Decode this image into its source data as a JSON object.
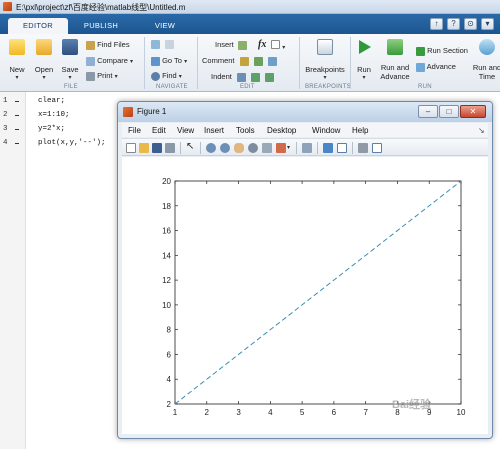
{
  "window": {
    "title": "E:\\pxl\\project\\zf\\百度经验\\matlab线型\\Untitled.m"
  },
  "tabs": [
    {
      "label": "EDITOR"
    },
    {
      "label": "PUBLISH"
    },
    {
      "label": "VIEW"
    }
  ],
  "window_buttons": [
    "↑",
    "?",
    "⊙",
    "▾"
  ],
  "ribbon": {
    "file": {
      "group": "FILE",
      "new": "New",
      "open": "Open",
      "save": "Save",
      "find_files": "Find Files",
      "compare": "Compare",
      "print": "Print"
    },
    "navigate": {
      "group": "NAVIGATE",
      "goto": "Go To",
      "find": "Find"
    },
    "edit": {
      "group": "EDIT",
      "insert": "Insert",
      "fx": "fx",
      "comment": "Comment",
      "indent": "Indent"
    },
    "breakpoints": {
      "group": "BREAKPOINTS",
      "label": "Breakpoints"
    },
    "run": {
      "group": "RUN",
      "run": "Run",
      "run_and_advance_1": "Run and",
      "run_and_advance_2": "Advance",
      "run_section": "Run Section",
      "advance": "Advance",
      "run_and_time_1": "Run and",
      "run_and_time_2": "Time"
    }
  },
  "editor": {
    "lines": [
      {
        "num": "1",
        "code": "clear;"
      },
      {
        "num": "2",
        "code": "x=1:10;"
      },
      {
        "num": "3",
        "code": "y=2*x;"
      },
      {
        "num": "4",
        "code": "plot(x,y,'--');"
      }
    ]
  },
  "figure": {
    "title": "Figure 1",
    "menu": [
      "File",
      "Edit",
      "View",
      "Insert",
      "Tools",
      "Desktop",
      "Window",
      "Help"
    ],
    "title_buttons": [
      "–",
      "□",
      "✕"
    ]
  },
  "chart_data": {
    "type": "line",
    "title": "",
    "xlabel": "",
    "ylabel": "",
    "xlim": [
      1,
      10
    ],
    "ylim": [
      2,
      20
    ],
    "xticks": [
      1,
      2,
      3,
      4,
      5,
      6,
      7,
      8,
      9,
      10
    ],
    "yticks": [
      2,
      4,
      6,
      8,
      10,
      12,
      14,
      16,
      18,
      20
    ],
    "grid": false,
    "series": [
      {
        "line_style": "dashed",
        "color": "#3a8fb0",
        "x": [
          1,
          2,
          3,
          4,
          5,
          6,
          7,
          8,
          9,
          10
        ],
        "y": [
          2,
          4,
          6,
          8,
          10,
          12,
          14,
          16,
          18,
          20
        ]
      }
    ]
  },
  "watermark": "Bai经验",
  "colors": {
    "tab_bar": "#1c5590",
    "ribbon": "#eef2f6",
    "run_green": "#2e9a3a"
  }
}
